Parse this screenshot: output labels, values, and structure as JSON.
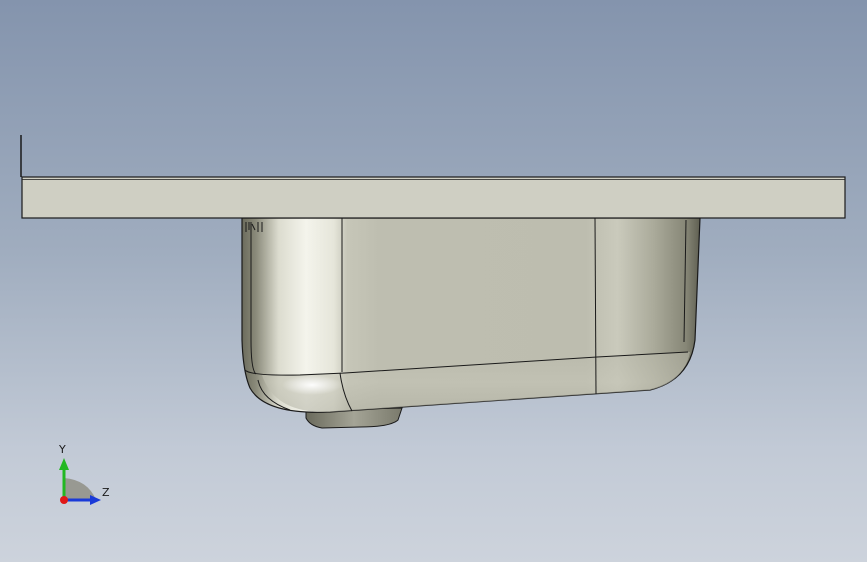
{
  "viewport": {
    "background_top": "#8494ad",
    "background_bottom": "#cdd3dc"
  },
  "model": {
    "countertop_color": "#cfcfc3",
    "basin_color": "#c8c8bc",
    "edge_color": "#1a1a1a"
  },
  "triad": {
    "y_label": "Y",
    "z_label": "Z",
    "x_color": "#e01818",
    "y_color": "#22b822",
    "z_color": "#1a3ad8"
  }
}
